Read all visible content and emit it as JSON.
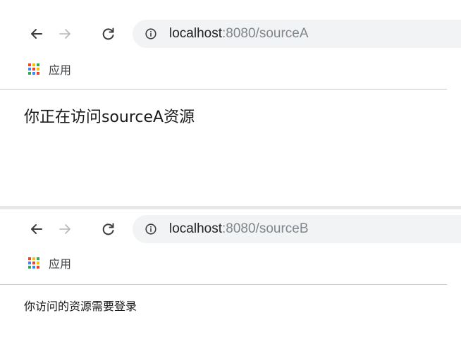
{
  "windows": [
    {
      "url_host": "localhost",
      "url_rest": ":8080/sourceA",
      "bookmark_label": "应用",
      "page_text": "你正在访问sourceA资源"
    },
    {
      "url_host": "localhost",
      "url_rest": ":8080/sourceB",
      "bookmark_label": "应用",
      "page_text": "你访问的资源需要登录"
    }
  ],
  "icons": {
    "back": "arrow-left-icon",
    "forward": "arrow-right-icon",
    "reload": "reload-icon",
    "info": "info-icon",
    "apps": "apps-grid-icon"
  },
  "colors": {
    "omnibox_bg": "#f1f3f4",
    "url_host": "#202124",
    "url_rest": "#80868b",
    "forward_disabled": "#b6b6b6",
    "apps_grid": [
      "#ea4335",
      "#fbbc05",
      "#34a853",
      "#4285f4",
      "#ea4335",
      "#fbbc05",
      "#34a853",
      "#4285f4",
      "#ea4335"
    ]
  }
}
